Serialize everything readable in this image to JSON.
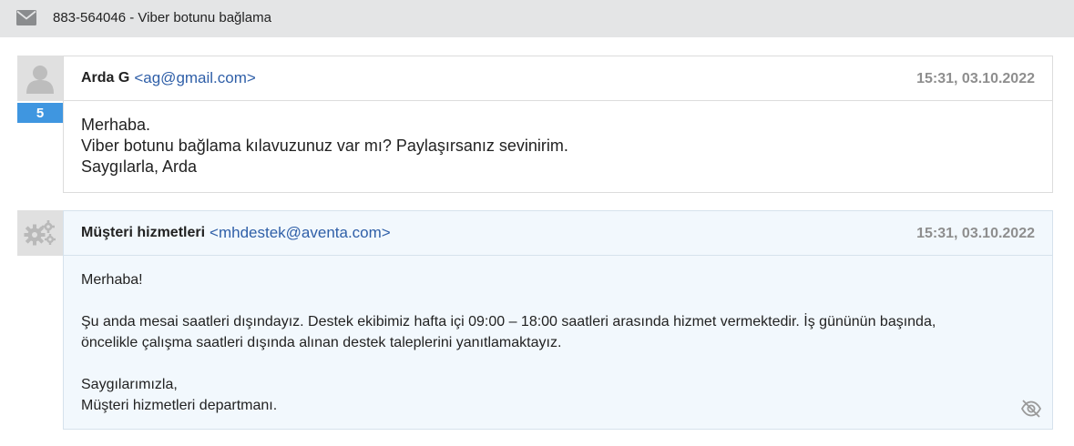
{
  "header": {
    "icon": "envelope-icon",
    "ticket_title": "883-564046 - Viber botunu bağlama"
  },
  "messages": [
    {
      "avatar_icon": "user-silhouette-icon",
      "badge": "5",
      "sender_name": "Arda G",
      "sender_email": "<ag@gmail.com>",
      "timestamp": "15:31, 03.10.2022",
      "lines": [
        "Merhaba.",
        "Viber botunu bağlama kılavuzunuz var mı? Paylaşırsanız sevinirim.",
        "Saygılarla, Arda"
      ]
    },
    {
      "avatar_icon": "gears-icon",
      "sender_name": "Müşteri hizmetleri",
      "sender_email": "<mhdestek@aventa.com>",
      "timestamp": "15:31, 03.10.2022",
      "paragraphs": [
        [
          "Merhaba!"
        ],
        [
          "Şu anda mesai saatleri dışındayız. Destek ekibimiz hafta içi 09:00 – 18:00 saatleri arasında hizmet vermektedir. İş gününün başında,",
          "öncelikle çalışma saatleri dışında alınan destek taleplerini yanıtlamaktayız."
        ],
        [
          "Saygılarımızla,",
          "Müşteri hizmetleri departmanı."
        ]
      ],
      "visibility_icon": "eye-off-icon"
    }
  ],
  "colors": {
    "topbar_bg": "#e4e5e6",
    "badge_bg": "#3f96e0",
    "email_link": "#2f5fa8",
    "timestamp": "#8e8e8e",
    "staff_card_bg": "#f2f8fd"
  }
}
